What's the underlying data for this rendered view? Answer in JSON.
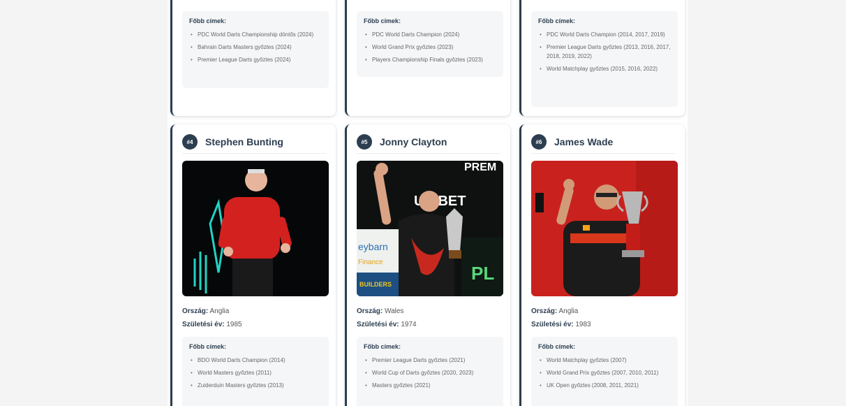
{
  "labels": {
    "titles_heading": "Főbb címek:",
    "country": "Ország:",
    "birth_year": "Születési év:"
  },
  "top_cards": [
    {
      "titles": [
        "PDC World Darts Championship döntős (2024)",
        "Bahrain Darts Masters győztes (2024)",
        "Premier League Darts győztes (2024)"
      ]
    },
    {
      "titles": [
        "PDC World Darts Champion (2024)",
        "World Grand Prix győztes (2023)",
        "Players Championship Finals győztes (2023)"
      ]
    },
    {
      "titles": [
        "PDC World Darts Champion (2014, 2017, 2019)",
        "Premier League Darts győztes (2013, 2016, 2017, 2018, 2019, 2022)",
        "World Matchplay győztes (2015, 2016, 2022)"
      ]
    }
  ],
  "players": [
    {
      "rank": "#4",
      "name": "Stephen Bunting",
      "country": "Anglia",
      "birth_year": "1985",
      "titles": [
        "BDO World Darts Champion (2014)",
        "World Masters győztes (2011)",
        "Zuiderduin Masters győztes (2013)"
      ]
    },
    {
      "rank": "#5",
      "name": "Jonny Clayton",
      "country": "Wales",
      "birth_year": "1974",
      "titles": [
        "Premier League Darts győztes (2021)",
        "World Cup of Darts győztes (2020, 2023)",
        "Masters győztes (2021)"
      ]
    },
    {
      "rank": "#6",
      "name": "James Wade",
      "country": "Anglia",
      "birth_year": "1983",
      "titles": [
        "World Matchplay győztes (2007)",
        "World Grand Prix győztes (2007, 2010, 2011)",
        "UK Open győztes (2008, 2011, 2021)"
      ]
    }
  ],
  "photo_text": {
    "sponsor1": "PREM",
    "sponsor2": "UNIBET",
    "sponsor3": "eybarn",
    "sponsor4": "Finance",
    "sponsor5": "BUILDERS",
    "sponsor6": "PL"
  }
}
